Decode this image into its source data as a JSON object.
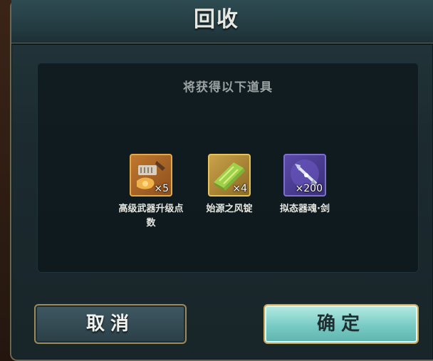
{
  "dialog": {
    "title": "回收",
    "panel_heading": "将获得以下道具",
    "items": [
      {
        "name": "高级武器升级点数",
        "count": "×5",
        "icon": "weapon-upgrade-points-icon",
        "frame_color": "#e2a84a"
      },
      {
        "name": "始源之风锭",
        "count": "×4",
        "icon": "wind-ingot-icon",
        "frame_color": "#e6c25a"
      },
      {
        "name": "拟态器魂·剑",
        "count": "×200",
        "icon": "sword-soul-icon",
        "frame_color": "#7d6fd0"
      }
    ],
    "cancel_label": "取消",
    "confirm_label": "确定"
  }
}
